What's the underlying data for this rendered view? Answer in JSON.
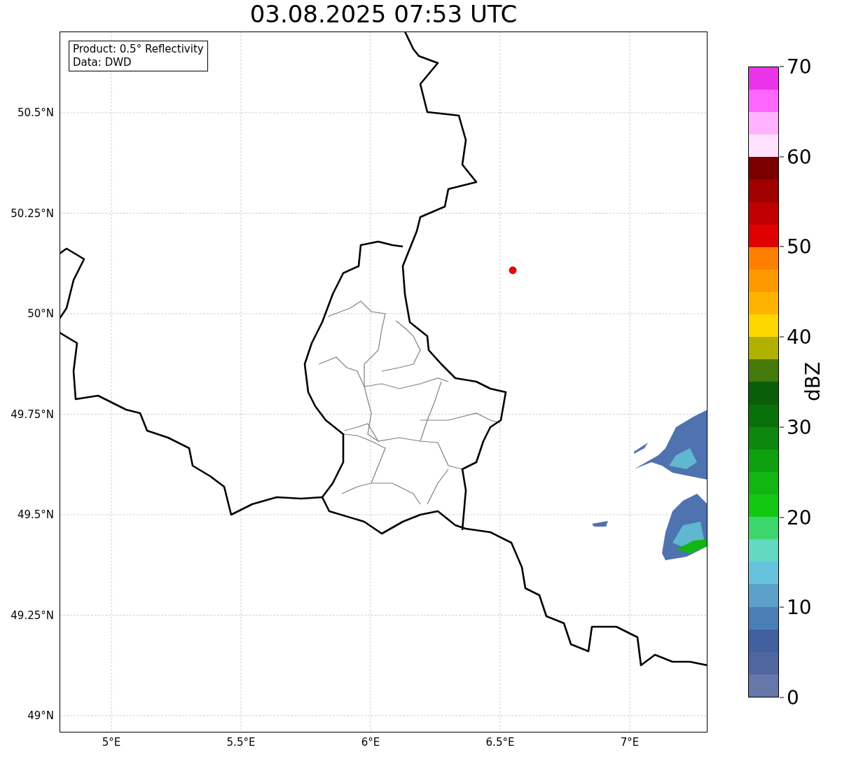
{
  "title": "03.08.2025 07:53 UTC",
  "info_box": {
    "lines": [
      "Product: 0.5° Reflectivity",
      "Data: DWD"
    ]
  },
  "lat_ticks": [
    "50.5°N",
    "50.25°N",
    "50°N",
    "49.75°N",
    "49.5°N",
    "49.25°N",
    "49°N"
  ],
  "lon_ticks": [
    "5°E",
    "5.5°E",
    "6°E",
    "6.5°E",
    "7°E"
  ],
  "colorbar": {
    "label": "dBZ",
    "ticks": [
      "70",
      "60",
      "50",
      "40",
      "30",
      "20",
      "10",
      "0"
    ],
    "segments": [
      {
        "color": "#6677aa"
      },
      {
        "color": "#5066a0"
      },
      {
        "color": "#4260a0"
      },
      {
        "color": "#4a7fb5"
      },
      {
        "color": "#5aa0c8"
      },
      {
        "color": "#66c2dd"
      },
      {
        "color": "#63d9c2"
      },
      {
        "color": "#3dd66d"
      },
      {
        "color": "#12c812"
      },
      {
        "color": "#12b512"
      },
      {
        "color": "#0fa00f"
      },
      {
        "color": "#0e870e"
      },
      {
        "color": "#0a700a"
      },
      {
        "color": "#0a5e0a"
      },
      {
        "color": "#447a0a"
      },
      {
        "color": "#b0b000"
      },
      {
        "color": "#ffd700"
      },
      {
        "color": "#ffb300"
      },
      {
        "color": "#ff9900"
      },
      {
        "color": "#ff7f00"
      },
      {
        "color": "#e00000"
      },
      {
        "color": "#c00000"
      },
      {
        "color": "#a00000"
      },
      {
        "color": "#7a0000"
      },
      {
        "color": "#ffe0ff"
      },
      {
        "color": "#ffb3ff"
      },
      {
        "color": "#ff66ff"
      },
      {
        "color": "#e935e9"
      }
    ]
  }
}
